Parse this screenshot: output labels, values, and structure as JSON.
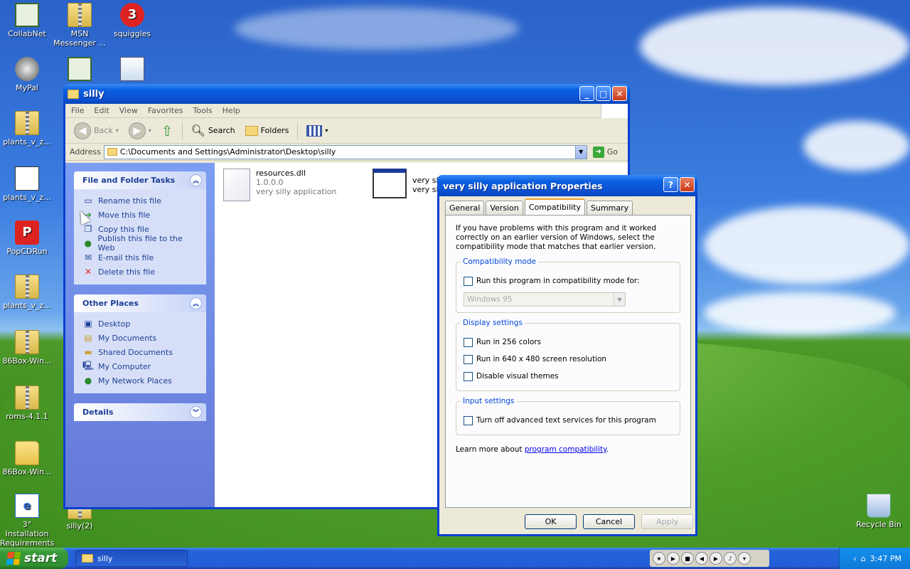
{
  "desktop": {
    "icons": [
      {
        "label": "CollabNet"
      },
      {
        "label": "MSN Messenger ..."
      },
      {
        "label": "squiggles"
      },
      {
        "label": "MyPal"
      },
      {
        "label": ""
      },
      {
        "label": ""
      },
      {
        "label": "plants_v_z..."
      },
      {
        "label": "plants_v_z..."
      },
      {
        "label": "PopCDRun"
      },
      {
        "label": "plants_v_z..."
      },
      {
        "label": "86Box-Win..."
      },
      {
        "label": "roms-4.1.1"
      },
      {
        "label": "86Box-Win..."
      },
      {
        "label": "3° Installation Requirements"
      },
      {
        "label": "silly(2)"
      },
      {
        "label": "Recycle Bin"
      }
    ]
  },
  "explorer": {
    "title": "silly",
    "menu": [
      "File",
      "Edit",
      "View",
      "Favorites",
      "Tools",
      "Help"
    ],
    "toolbar": {
      "back": "Back",
      "search": "Search",
      "folders": "Folders"
    },
    "address": {
      "label": "Address",
      "value": "C:\\Documents and Settings\\Administrator\\Desktop\\silly",
      "go": "Go"
    },
    "tasks": {
      "title": "File and Folder Tasks",
      "items": [
        "Rename this file",
        "Move this file",
        "Copy this file",
        "Publish this file to the Web",
        "E-mail this file",
        "Delete this file"
      ]
    },
    "places": {
      "title": "Other Places",
      "items": [
        "Desktop",
        "My Documents",
        "Shared Documents",
        "My Computer",
        "My Network Places"
      ]
    },
    "details": {
      "title": "Details"
    },
    "files": [
      {
        "name": "resources.dll",
        "version": "1.0.0.0",
        "desc": "very silly application"
      },
      {
        "name": "very sill",
        "desc": "very sill"
      }
    ]
  },
  "dialog": {
    "title": "very silly application Properties",
    "tabs": [
      "General",
      "Version",
      "Compatibility",
      "Summary"
    ],
    "intro": "If you have problems with this program and it worked correctly on an earlier version of Windows, select the compatibility mode that matches that earlier version.",
    "compat": {
      "legend": "Compatibility mode",
      "check": "Run this program in compatibility mode for:",
      "select": "Windows 95"
    },
    "display": {
      "legend": "Display settings",
      "checks": [
        "Run in 256 colors",
        "Run in 640 x 480 screen resolution",
        "Disable visual themes"
      ]
    },
    "input": {
      "legend": "Input settings",
      "check": "Turn off advanced text services for this program"
    },
    "learn_prefix": "Learn more about",
    "learn_link": "program compatibility",
    "learn_suffix": ".",
    "buttons": {
      "ok": "OK",
      "cancel": "Cancel",
      "apply": "Apply"
    }
  },
  "taskbar": {
    "start": "start",
    "task": "silly",
    "clock": "3:47 PM"
  }
}
